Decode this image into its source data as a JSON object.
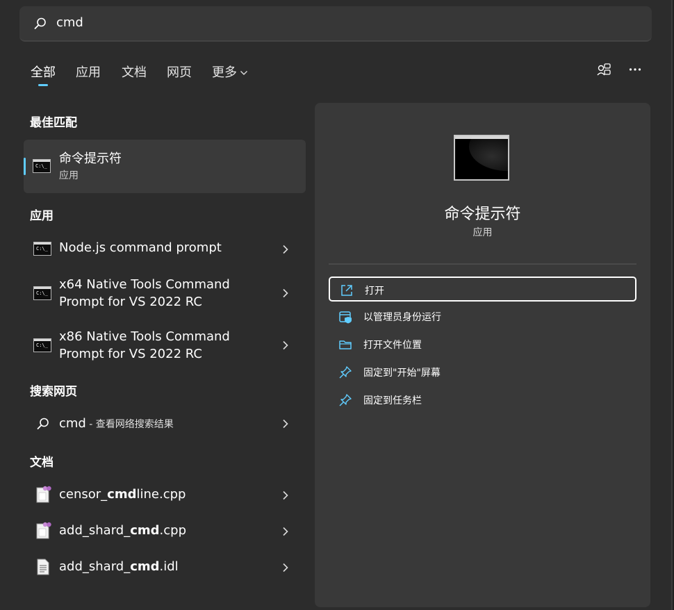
{
  "search": {
    "query": "cmd"
  },
  "tabs": [
    {
      "label": "全部",
      "active": true
    },
    {
      "label": "应用"
    },
    {
      "label": "文档"
    },
    {
      "label": "网页"
    },
    {
      "label": "更多"
    }
  ],
  "sections": {
    "best": "最佳匹配",
    "apps": "应用",
    "web": "搜索网页",
    "docs": "文档"
  },
  "best_match": {
    "title": "命令提示符",
    "subtitle": "应用",
    "icon_text": "C:\\_"
  },
  "apps": [
    {
      "line1": "Node.js command prompt",
      "icon_text": "C:\\_"
    },
    {
      "line1": "x64 Native Tools Command",
      "line2": "Prompt for VS 2022 RC",
      "icon_text": "C:\\_"
    },
    {
      "line1": "x86 Native Tools Command",
      "line2": "Prompt for VS 2022 RC",
      "icon_text": "C:\\_"
    }
  ],
  "web": {
    "term": "cmd",
    "note": " - 查看网络搜索结果"
  },
  "docs": [
    {
      "pre": "censor_",
      "bold": "cmd",
      "post": "line.cpp",
      "icon": "cpp-file-icon"
    },
    {
      "pre": "add_shard_",
      "bold": "cmd",
      "post": ".cpp",
      "icon": "cpp-file-icon"
    },
    {
      "pre": "add_shard_",
      "bold": "cmd",
      "post": ".idl",
      "icon": "text-file-icon"
    }
  ],
  "preview": {
    "title": "命令提示符",
    "subtitle": "应用"
  },
  "actions": [
    {
      "label": "打开",
      "icon": "open-external-icon"
    },
    {
      "label": "以管理员身份运行",
      "icon": "admin-shield-icon"
    },
    {
      "label": "打开文件位置",
      "icon": "folder-icon"
    },
    {
      "label": "固定到\"开始\"屏幕",
      "icon": "pin-icon"
    },
    {
      "label": "固定到任务栏",
      "icon": "pin-icon"
    }
  ],
  "colors": {
    "accent": "#60cdff",
    "panel": "#2c2c2c",
    "pane": "#393939"
  }
}
